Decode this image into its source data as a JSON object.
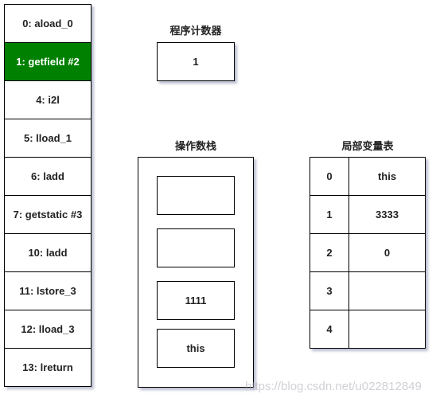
{
  "bytecode": {
    "instructions": [
      {
        "label": "0: aload_0",
        "active": false
      },
      {
        "label": "1: getfield #2",
        "active": true
      },
      {
        "label": "4: i2l",
        "active": false
      },
      {
        "label": "5: lload_1",
        "active": false
      },
      {
        "label": "6: ladd",
        "active": false
      },
      {
        "label": "7: getstatic #3",
        "active": false
      },
      {
        "label": "10: ladd",
        "active": false
      },
      {
        "label": "11: lstore_3",
        "active": false
      },
      {
        "label": "12: lload_3",
        "active": false
      },
      {
        "label": "13: lreturn",
        "active": false
      }
    ],
    "active_color": "#008000"
  },
  "program_counter": {
    "title": "程序计数器",
    "value": "1"
  },
  "operand_stack": {
    "title": "操作数栈",
    "slots": [
      "",
      "",
      "1111",
      "this"
    ]
  },
  "local_variables": {
    "title": "局部变量表",
    "rows": [
      {
        "index": "0",
        "value": "this"
      },
      {
        "index": "1",
        "value": "3333"
      },
      {
        "index": "2",
        "value": "0"
      },
      {
        "index": "3",
        "value": ""
      },
      {
        "index": "4",
        "value": ""
      }
    ]
  },
  "watermark": "https://blog.csdn.net/u022812849"
}
